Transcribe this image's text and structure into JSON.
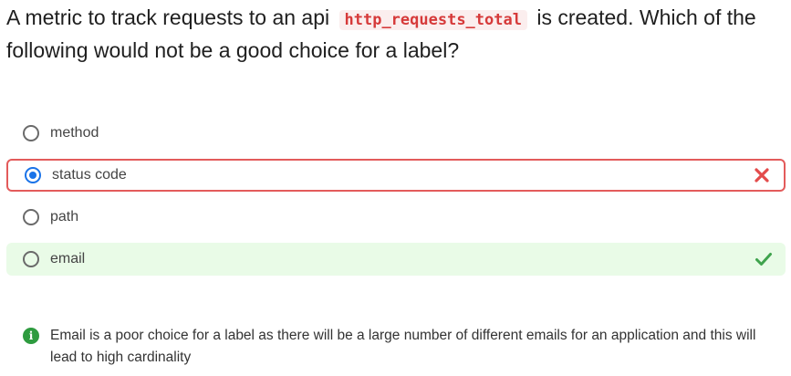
{
  "question": {
    "prefix": "A metric to track requests to an api",
    "code": "http_requests_total",
    "suffix": "is created. Which of the following would not be a good choice for a label?"
  },
  "options": [
    {
      "label": "method",
      "selected": false,
      "state": "neutral"
    },
    {
      "label": "status code",
      "selected": true,
      "state": "incorrect"
    },
    {
      "label": "path",
      "selected": false,
      "state": "neutral"
    },
    {
      "label": "email",
      "selected": false,
      "state": "correct"
    }
  ],
  "explanation": {
    "icon": "info-icon",
    "text": "Email is a poor choice for a label as there will be a large number of different emails for an application and this will lead to high cardinality"
  },
  "colors": {
    "code_text": "#d63a3a",
    "code_bg": "#fbeeee",
    "selected_radio": "#1a73e8",
    "incorrect_border": "#e35b5b",
    "incorrect_mark": "#e34b4b",
    "correct_bg": "#e9fbe7",
    "correct_mark": "#3fa34d",
    "info_icon": "#2e9b3f"
  }
}
